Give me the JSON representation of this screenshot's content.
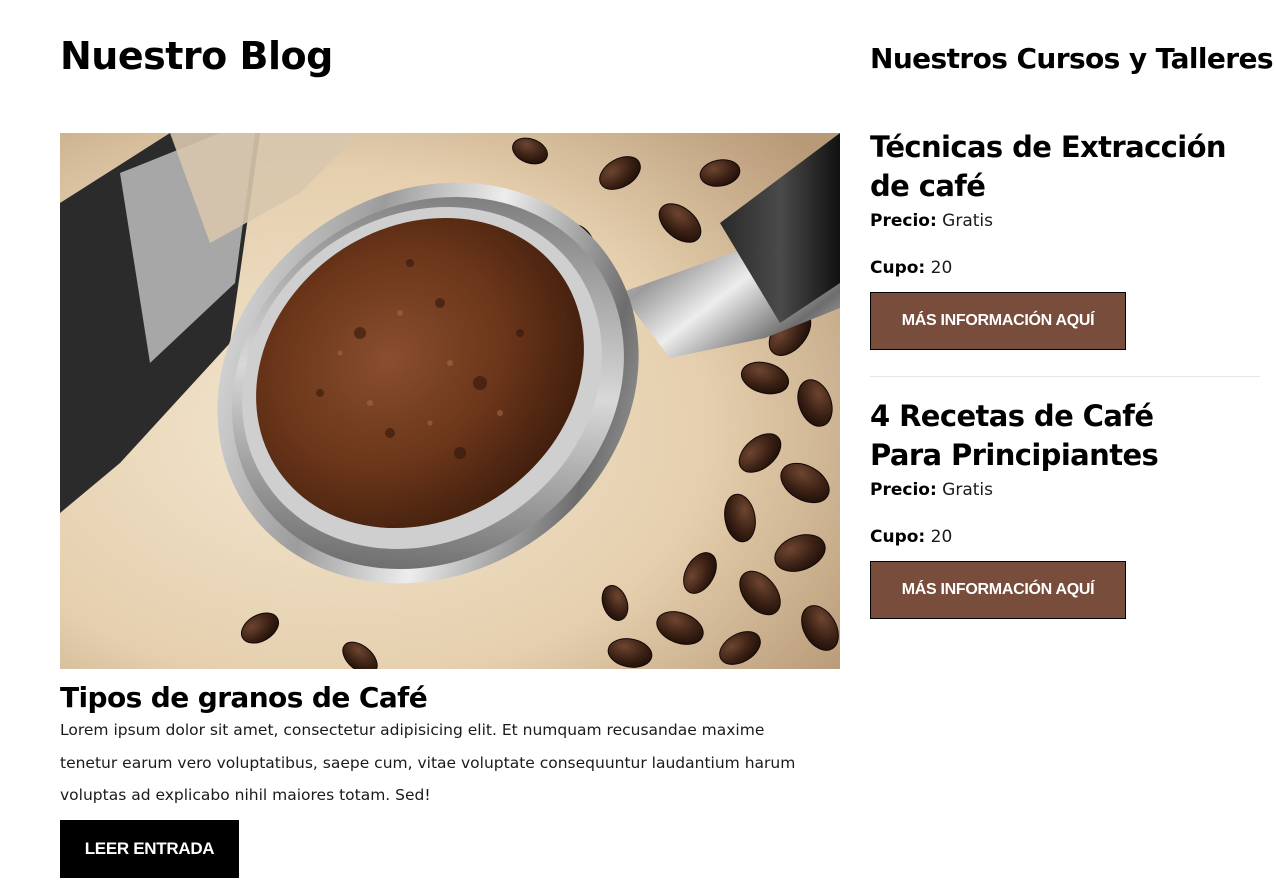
{
  "blog": {
    "heading": "Nuestro Blog",
    "post": {
      "title": "Tipos de granos de Café",
      "excerpt": "Lorem ipsum dolor sit amet, consectetur adipisicing elit. Et numquam recusandae maxime tenetur earum vero voluptatibus, saepe cum, vitae voluptate consequuntur laudantium harum voluptas ad explicabo nihil maiores totam. Sed!",
      "button_label": "LEER ENTRADA"
    }
  },
  "sidebar": {
    "heading": "Nuestros Cursos y Talleres",
    "courses": [
      {
        "title": "Técnicas de Extracción de café",
        "price_label": "Precio:",
        "price_value": "Gratis",
        "cupo_label": "Cupo:",
        "cupo_value": "20",
        "button_label": "MÁS INFORMACIÓN AQUÍ"
      },
      {
        "title": "4 Recetas de Café Para Principiantes",
        "price_label": "Precio:",
        "price_value": "Gratis",
        "cupo_label": "Cupo:",
        "cupo_value": "20",
        "button_label": "MÁS INFORMACIÓN AQUÍ"
      }
    ]
  },
  "colors": {
    "accent_button": "#784d3c",
    "primary_button": "#000000",
    "text": "#000000",
    "background": "#ffffff"
  }
}
